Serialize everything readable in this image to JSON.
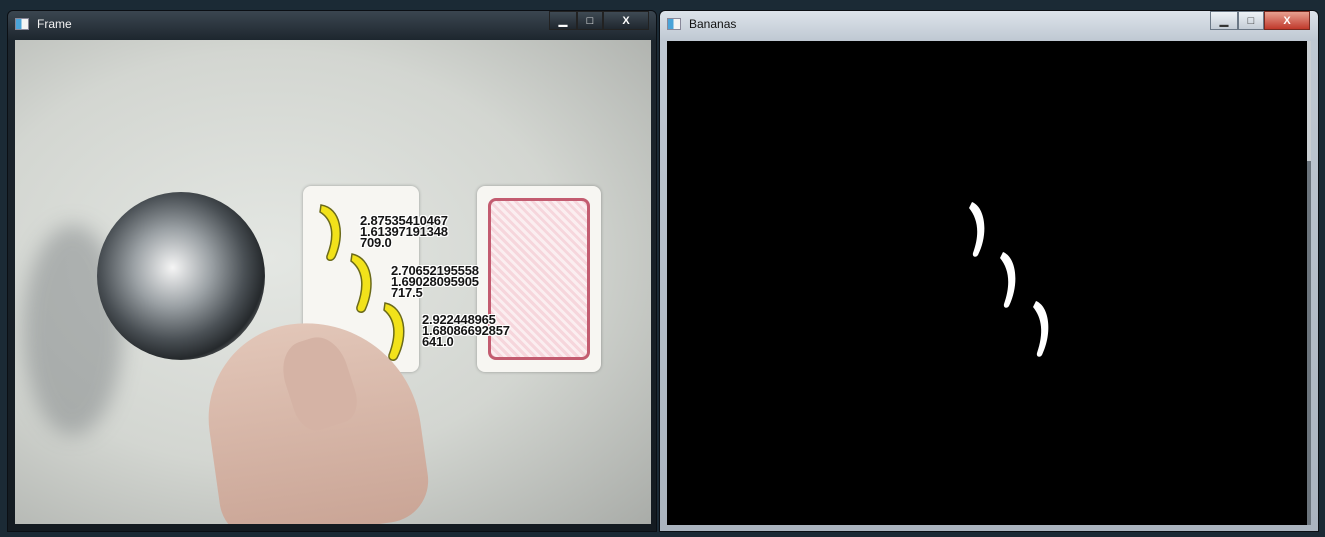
{
  "windows": [
    {
      "title": "Frame",
      "detections": [
        {
          "ratio": "2.87535410467",
          "ratio2": "1.61397191348",
          "area": "709.0"
        },
        {
          "ratio": "2.70652195558",
          "ratio2": "1.69028095905",
          "area": "717.5"
        },
        {
          "ratio": "2.922448965",
          "ratio2": "1.68086692857",
          "area": "641.0"
        }
      ]
    },
    {
      "title": "Bananas"
    }
  ],
  "caption_buttons": {
    "minimize": "▁",
    "maximize": "□",
    "close": "X"
  },
  "icons": {
    "window_icon": "app-window-icon",
    "banana": "banana-contour"
  },
  "colors": {
    "contour": "#f2e21a",
    "contour_outline": "#6b6a1a",
    "mask_bg": "#000000",
    "mask_fg": "#ffffff"
  }
}
